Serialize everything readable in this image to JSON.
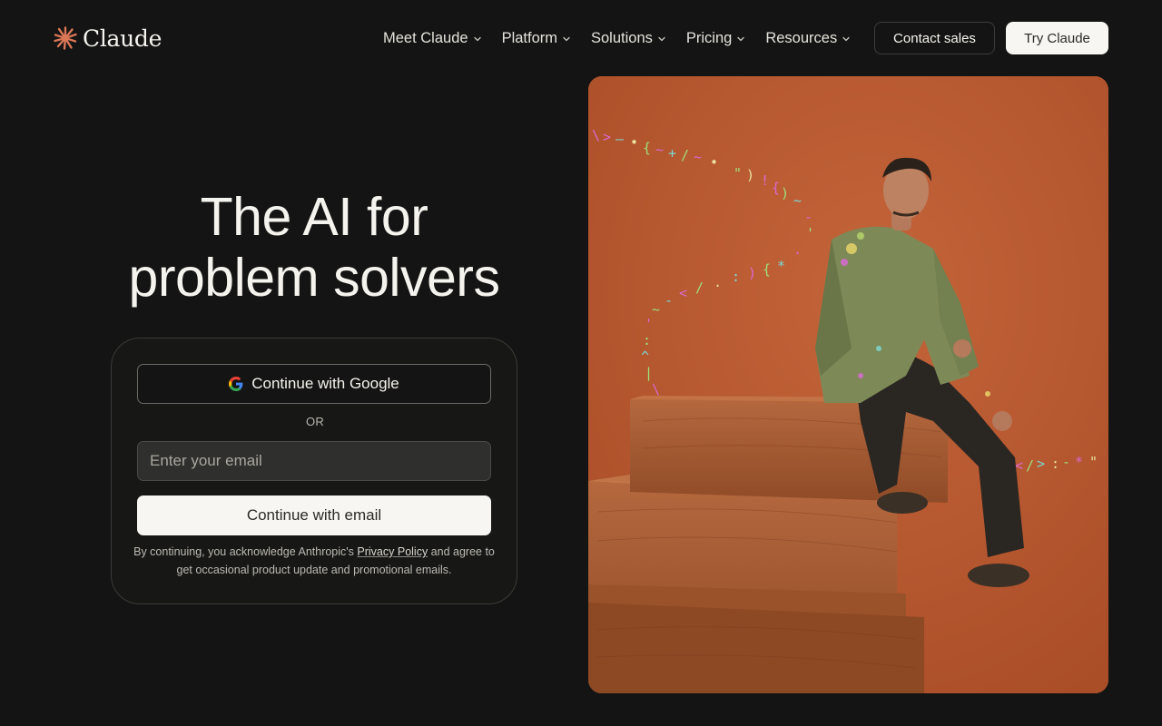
{
  "brand": {
    "name": "Claude"
  },
  "nav": {
    "items": [
      {
        "label": "Meet Claude"
      },
      {
        "label": "Platform"
      },
      {
        "label": "Solutions"
      },
      {
        "label": "Pricing"
      },
      {
        "label": "Resources"
      }
    ],
    "contact_label": "Contact sales",
    "try_label": "Try Claude"
  },
  "hero": {
    "title_line1": "The AI for",
    "title_line2": "problem solvers"
  },
  "signup": {
    "google_label": "Continue with Google",
    "or_label": "OR",
    "email_placeholder": "Enter your email",
    "email_value": "",
    "email_button": "Continue with email",
    "legal_pre": "By continuing, you acknowledge Anthropic's ",
    "legal_link": "Privacy Policy",
    "legal_post": " and agree to get occasional product update and promotional emails."
  },
  "colors": {
    "background": "#141414",
    "accent_orange": "#d97757",
    "photo_backdrop": "#b8572e"
  },
  "icons": {
    "logo": "claude-starburst-icon",
    "dropdown": "chevron-down-icon",
    "google": "google-g-icon"
  }
}
